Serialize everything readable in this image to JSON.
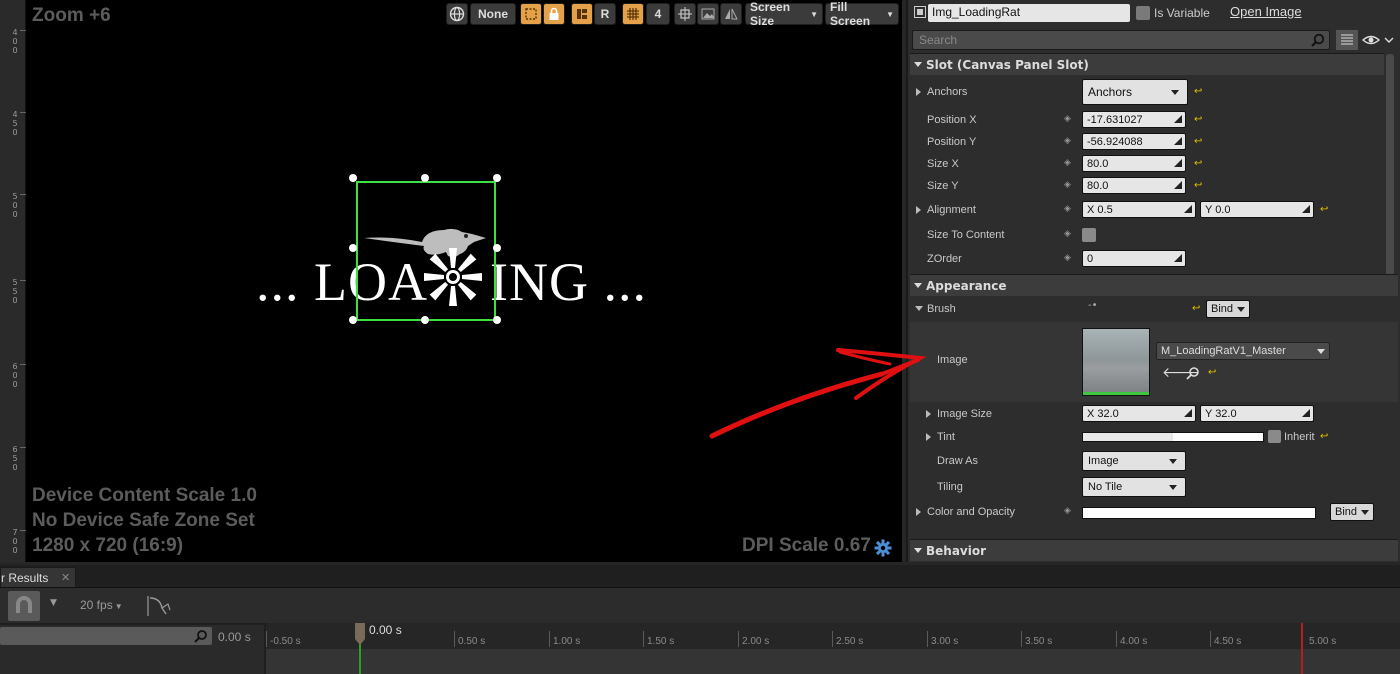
{
  "viewport": {
    "zoom": "Zoom +6",
    "info_line1": "Device Content Scale 1.0",
    "info_line2": "No Device Safe Zone Set",
    "info_line3": "1280 x 720 (16:9)",
    "dpi_scale": "DPI Scale 0.67",
    "loading_left": "... LOA",
    "loading_right": "ING ...",
    "toolbar": {
      "none_label": "None",
      "r_label": "R",
      "grid_value": "4",
      "screen_size": "Screen Size",
      "fill_screen": "Fill Screen"
    },
    "ruler_labels": [
      "4 0 0",
      "4 5 0",
      "5 0 0",
      "5 5 0",
      "6 0 0",
      "6 5 0",
      "7 0 0"
    ]
  },
  "details": {
    "widget_name": "Img_LoadingRat",
    "is_variable_label": "Is Variable",
    "open_image_label": "Open Image",
    "search_placeholder": "Search",
    "slot_section": "Slot (Canvas Panel Slot)",
    "anchors_label": "Anchors",
    "anchors_value": "Anchors",
    "position_x_label": "Position X",
    "position_x_value": "-17.631027",
    "position_y_label": "Position Y",
    "position_y_value": "-56.924088",
    "size_x_label": "Size X",
    "size_x_value": "80.0",
    "size_y_label": "Size Y",
    "size_y_value": "80.0",
    "alignment_label": "Alignment",
    "alignment_x": "X  0.5",
    "alignment_y": "Y  0.0",
    "size_to_content_label": "Size To Content",
    "zorder_label": "ZOrder",
    "zorder_value": "0",
    "appearance_section": "Appearance",
    "brush_label": "Brush",
    "bind_label": "Bind",
    "image_label": "Image",
    "image_asset": "M_LoadingRatV1_Master",
    "image_size_label": "Image Size",
    "image_size_x": "X  32.0",
    "image_size_y": "Y  32.0",
    "tint_label": "Tint",
    "inherit_label": "Inherit",
    "draw_as_label": "Draw As",
    "draw_as_value": "Image",
    "tiling_label": "Tiling",
    "tiling_value": "No Tile",
    "color_opacity_label": "Color and Opacity",
    "color_bind_label": "Bind",
    "behavior_section": "Behavior"
  },
  "bottom": {
    "tab_label": "r Results",
    "fps": "20 fps",
    "time_readout": "0.00 s",
    "playhead_time": "0.00 s",
    "ticks": [
      "-0.50 s",
      "0.00 s",
      "0.50 s",
      "1.00 s",
      "1.50 s",
      "2.00 s",
      "2.50 s",
      "3.00 s",
      "3.50 s",
      "4.00 s",
      "4.50 s",
      "5.00 s"
    ]
  },
  "colors": {
    "accent_orange": "#e5a04a",
    "selection_green": "#3ee03e",
    "annotation_red": "#e01010",
    "reset_yellow": "#e0c000"
  }
}
